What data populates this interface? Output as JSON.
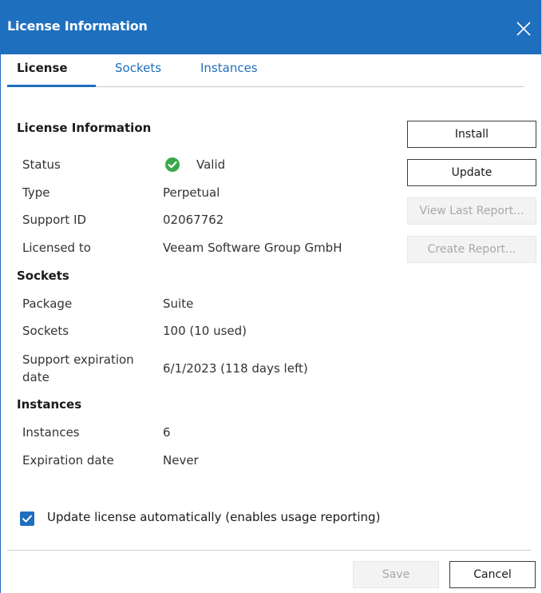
{
  "window": {
    "title": "License Information"
  },
  "tabs": [
    {
      "label": "License",
      "active": true
    },
    {
      "label": "Sockets",
      "active": false
    },
    {
      "label": "Instances",
      "active": false
    }
  ],
  "license_info": {
    "heading": "License Information",
    "rows": [
      {
        "label": "Status",
        "value": "Valid"
      },
      {
        "label": "Type",
        "value": "Perpetual"
      },
      {
        "label": "Support ID",
        "value": "02067762"
      },
      {
        "label": "Licensed to",
        "value": "Veeam Software Group GmbH"
      }
    ]
  },
  "sockets": {
    "heading": "Sockets",
    "rows": [
      {
        "label": "Package",
        "value": "Suite"
      },
      {
        "label": "Sockets",
        "value": "100 (10 used)"
      },
      {
        "label": "Support expiration date",
        "value": "6/1/2023 (118 days left)"
      }
    ]
  },
  "instances": {
    "heading": "Instances",
    "rows": [
      {
        "label": "Instances",
        "value": "6"
      },
      {
        "label": "Expiration date",
        "value": "Never"
      }
    ]
  },
  "buttons": {
    "install": "Install",
    "update": "Update",
    "view_last_report": "View Last Report...",
    "create_report": "Create Report..."
  },
  "auto_update": {
    "label": "Update license automatically (enables usage reporting)",
    "checked": true
  },
  "footer": {
    "save": "Save",
    "cancel": "Cancel"
  },
  "icons": {
    "close": "close-icon",
    "status": "check-circle-icon",
    "checkbox": "checkmark-icon"
  },
  "colors": {
    "accent": "#1f6fbf",
    "status_ok": "#3aa84a",
    "disabled_text": "#a8a8a8"
  }
}
